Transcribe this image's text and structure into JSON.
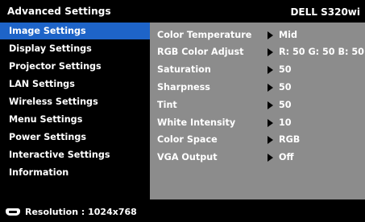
{
  "header": {
    "title": "Advanced Settings",
    "model": "DELL S320wi"
  },
  "sidebar": {
    "items": [
      {
        "label": "Image Settings",
        "active": true
      },
      {
        "label": "Display Settings"
      },
      {
        "label": "Projector Settings"
      },
      {
        "label": "LAN Settings"
      },
      {
        "label": "Wireless Settings"
      },
      {
        "label": "Menu Settings"
      },
      {
        "label": "Power Settings"
      },
      {
        "label": "Interactive Settings"
      },
      {
        "label": "Information"
      }
    ]
  },
  "panel": {
    "rows": [
      {
        "label": "Color Temperature",
        "value": "Mid"
      },
      {
        "label": "RGB Color Adjust",
        "value": "R: 50 G: 50 B: 50"
      },
      {
        "label": "Saturation",
        "value": "50"
      },
      {
        "label": "Sharpness",
        "value": "50"
      },
      {
        "label": "Tint",
        "value": "50"
      },
      {
        "label": "White Intensity",
        "value": "10"
      },
      {
        "label": "Color Space",
        "value": "RGB"
      },
      {
        "label": "VGA Output",
        "value": "Off"
      }
    ]
  },
  "footer": {
    "resolution": "Resolution : 1024x768",
    "source_icon": "vga-connector-icon"
  },
  "colors": {
    "active_item": "#1e64c8",
    "panel_bg": "#8c8c8c",
    "background": "#000000"
  }
}
